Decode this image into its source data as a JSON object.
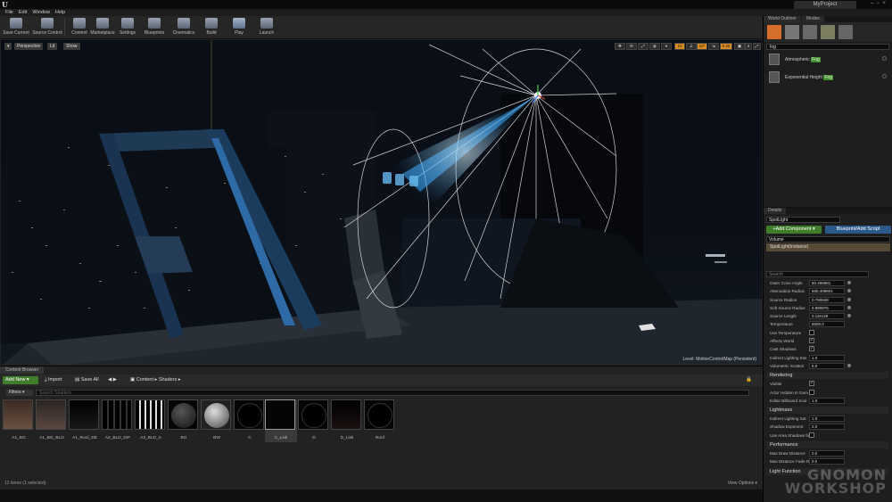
{
  "window": {
    "project": "MyProject"
  },
  "menu": [
    "File",
    "Edit",
    "Window",
    "Help"
  ],
  "toolbar": [
    {
      "label": "Save Current",
      "icon": "save-icon"
    },
    {
      "label": "Source Control",
      "icon": "source-control-icon"
    },
    {
      "label": "Content",
      "icon": "content-icon"
    },
    {
      "label": "Marketplace",
      "icon": "marketplace-icon"
    },
    {
      "label": "Settings",
      "icon": "settings-icon"
    },
    {
      "label": "Blueprints",
      "icon": "blueprints-icon"
    },
    {
      "label": "Cinematics",
      "icon": "cinematics-icon"
    },
    {
      "label": "Build",
      "icon": "build-icon"
    },
    {
      "label": "Play",
      "icon": "play-icon"
    },
    {
      "label": "Launch",
      "icon": "launch-icon"
    }
  ],
  "viewport": {
    "view_mode": "Perspective",
    "lighting": "Lit",
    "show": "Show",
    "grid_snap": "10",
    "rotation_snap": "10°",
    "scale_snap": "0.25",
    "camera_speed": "4",
    "level_prefix": "Level:",
    "level_name": "MotionControlMap (Persistent)"
  },
  "outliner": {
    "tabs": [
      "World Outliner",
      "Modes"
    ],
    "search": "fog",
    "items": [
      {
        "prefix": "Atmospheric ",
        "highlight": "Fog"
      },
      {
        "prefix": "Exponential Height ",
        "highlight": "Fog"
      }
    ]
  },
  "details": {
    "tab": "Details",
    "actor_name": "SpotLight",
    "add_component": "+Add Component ▾",
    "blueprint": "Blueprint/Add Script",
    "component_filter": "Volume",
    "selected_component": "SpotLight(Instance)",
    "search": "Search",
    "props_light": [
      {
        "k": "Outer Cone Angle",
        "v": "60.466881"
      },
      {
        "k": "Attenuation Radius",
        "v": "500.409801"
      },
      {
        "k": "Source Radius",
        "v": "0.790849"
      },
      {
        "k": "Soft Source Radius",
        "v": "0.980876"
      },
      {
        "k": "Source Length",
        "v": "0.116128"
      },
      {
        "k": "Temperature",
        "v": "6500.0"
      },
      {
        "k": "Use Temperature",
        "cb": ""
      },
      {
        "k": "Affects World",
        "cb": "✓"
      },
      {
        "k": "Cast Shadows",
        "cb": "✓"
      },
      {
        "k": "Indirect Lighting Inte",
        "v": "1.0"
      },
      {
        "k": "Volumetric Scatteri",
        "v": "6.0"
      }
    ],
    "section_rendering": "Rendering",
    "props_rendering": [
      {
        "k": "Visible",
        "cb": "✓"
      },
      {
        "k": "Actor Hidden In Gam",
        "cb": ""
      },
      {
        "k": "Editor Billboard Scal",
        "v": "1.0"
      }
    ],
    "section_lightmass": "Lightmass",
    "props_lightmass": [
      {
        "k": "Indirect Lighting Sat",
        "v": "1.0"
      },
      {
        "k": "Shadow Exponent",
        "v": "2.0"
      },
      {
        "k": "Use Area Shadows fo",
        "cb": ""
      }
    ],
    "section_performance": "Performance",
    "props_performance": [
      {
        "k": "Max Draw Distance",
        "v": "0.0"
      },
      {
        "k": "Max Distance Fade R",
        "v": "0.0"
      }
    ],
    "section_light_function": "Light Function"
  },
  "watermark": [
    "GNOMON",
    "WORKSHOP"
  ],
  "content_browser": {
    "tab": "Content Browser",
    "add_new": "Add New ▾",
    "import": "Import",
    "save_all": "Save All",
    "path": [
      "Content",
      "Shaders"
    ],
    "filters": "Filters ▾",
    "search_placeholder": "Search Shaders",
    "assets": [
      "A1_BG",
      "A1_BG_BLO",
      "A1_Roof_DE",
      "A2_BLD_DIF",
      "A3_BLD_X",
      "BG",
      "BW",
      "C",
      "C_Lisk",
      "D",
      "D_Lisk",
      "Roof"
    ],
    "items_count": "12 items (1 selected)",
    "view_options": "View Options ▾"
  }
}
